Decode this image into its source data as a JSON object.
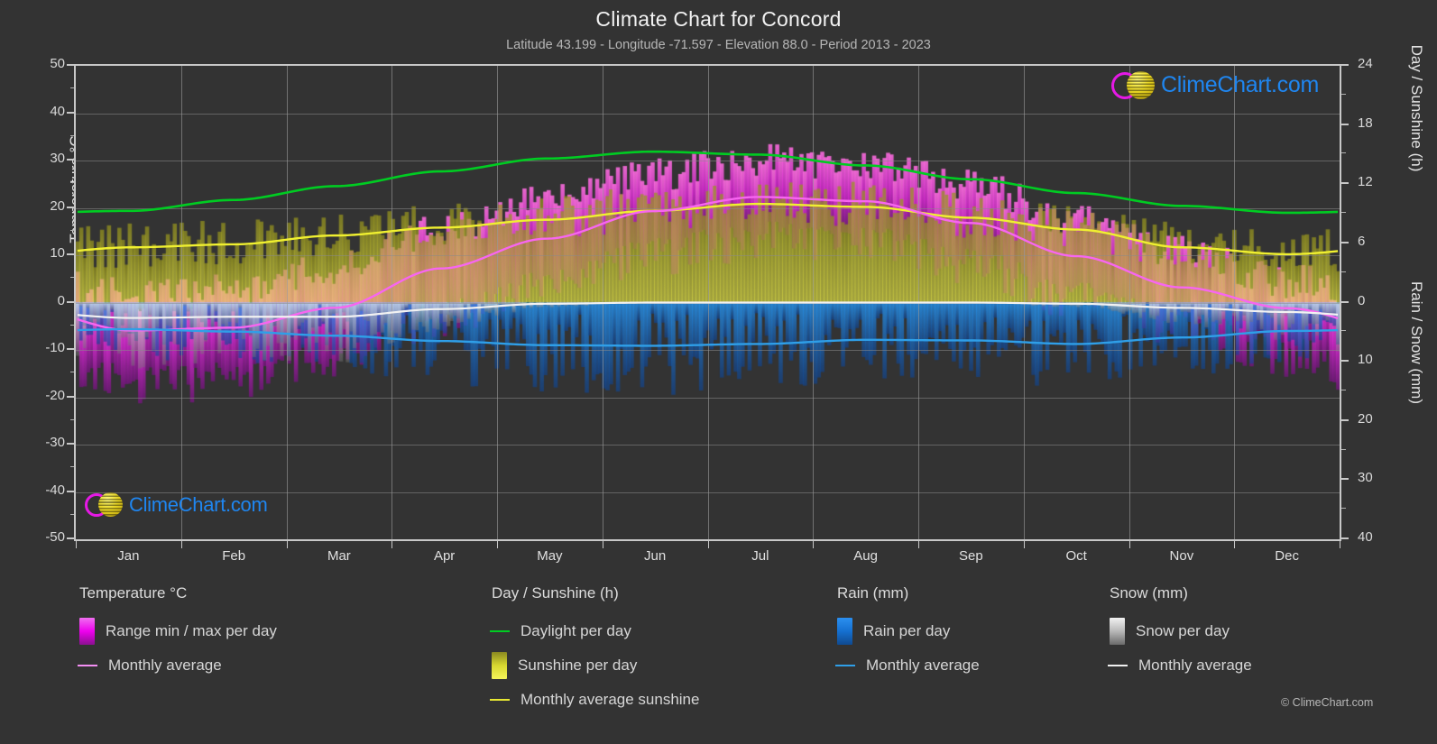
{
  "header": {
    "title": "Climate Chart for Concord",
    "subtitle": "Latitude 43.199 - Longitude -71.597 - Elevation 88.0 - Period 2013 - 2023"
  },
  "watermark": {
    "text": "ClimeChart.com"
  },
  "copyright": "© ClimeChart.com",
  "legend": {
    "columns": [
      {
        "title": "Temperature °C",
        "items": [
          {
            "label": "Range min / max per day",
            "marker": "gradient-swatch",
            "color": "#ee00ee"
          },
          {
            "label": "Monthly average",
            "marker": "line",
            "color": "#f48ff4"
          }
        ]
      },
      {
        "title": "Day / Sunshine (h)",
        "items": [
          {
            "label": "Daylight per day",
            "marker": "line",
            "color": "#00cc22"
          },
          {
            "label": "Sunshine per day",
            "marker": "gradient-swatch",
            "color": "#e8e833"
          },
          {
            "label": "Monthly average sunshine",
            "marker": "line",
            "color": "#e8e833"
          }
        ]
      },
      {
        "title": "Rain (mm)",
        "items": [
          {
            "label": "Rain per day",
            "marker": "gradient-swatch",
            "color": "#1a7fe0"
          },
          {
            "label": "Monthly average",
            "marker": "line",
            "color": "#2f9fe8"
          }
        ]
      },
      {
        "title": "Snow (mm)",
        "items": [
          {
            "label": "Snow per day",
            "marker": "gradient-swatch",
            "color": "#d8d8d8"
          },
          {
            "label": "Monthly average",
            "marker": "line",
            "color": "#f0f0f0"
          }
        ]
      }
    ]
  },
  "chart_data": {
    "type": "line",
    "title": "Climate Chart for Concord",
    "subtitle": "Latitude 43.199 - Longitude -71.597 - Elevation 88.0 - Period 2013 - 2023",
    "categories": [
      "Jan",
      "Feb",
      "Mar",
      "Apr",
      "May",
      "Jun",
      "Jul",
      "Aug",
      "Sep",
      "Oct",
      "Nov",
      "Dec"
    ],
    "xlabel": "",
    "grid": true,
    "legend_position": "below",
    "axes": {
      "left": {
        "label": "Temperature °C",
        "ylim": [
          -50,
          50
        ],
        "ticks": [
          50,
          40,
          30,
          20,
          10,
          0,
          -10,
          -20,
          -30,
          -40,
          -50
        ]
      },
      "right_upper": {
        "label": "Day / Sunshine (h)",
        "ylim": [
          0,
          24
        ],
        "ticks": [
          24,
          18,
          12,
          6,
          0
        ],
        "note": "0 h aligns with 0 °C; 24 h aligns with 50 °C"
      },
      "right_lower": {
        "label": "Rain / Snow (mm)",
        "ylim": [
          0,
          40
        ],
        "ticks": [
          0,
          10,
          20,
          30,
          40
        ],
        "note": "0 mm aligns with 0 °C and increases downward to 40 mm at -50 °C"
      }
    },
    "series": [
      {
        "name": "Daylight per day",
        "unit": "h",
        "axis": "right_upper",
        "color": "#00cc22",
        "values": [
          9.3,
          10.4,
          11.8,
          13.3,
          14.6,
          15.3,
          15.0,
          13.9,
          12.5,
          11.1,
          9.8,
          9.1
        ]
      },
      {
        "name": "Monthly average sunshine",
        "unit": "h",
        "axis": "right_upper",
        "color": "#e8e833",
        "values": [
          5.6,
          5.9,
          6.8,
          7.6,
          8.4,
          9.3,
          10.0,
          9.7,
          8.6,
          7.4,
          5.6,
          4.9
        ]
      },
      {
        "name": "Monthly average temperature",
        "unit": "°C",
        "axis": "left",
        "color": "#f48ff4",
        "values": [
          -5.9,
          -5.3,
          -1.1,
          7.2,
          13.5,
          19.3,
          22.3,
          21.4,
          16.8,
          9.8,
          3.2,
          -1.2
        ]
      },
      {
        "name": "Monthly average rain",
        "unit": "mm",
        "axis": "right_lower",
        "color": "#2f9fe8",
        "values": [
          4.5,
          4.9,
          5.6,
          6.5,
          7.2,
          7.3,
          7.0,
          6.3,
          6.4,
          7.0,
          5.9,
          4.8
        ]
      },
      {
        "name": "Monthly average snow",
        "unit": "mm",
        "axis": "right_lower",
        "color": "#f0f0f0",
        "values": [
          2.6,
          2.4,
          2.4,
          1.1,
          0.2,
          0.0,
          0.0,
          0.0,
          0.0,
          0.2,
          0.9,
          1.6
        ]
      },
      {
        "name": "Temperature range min per day",
        "unit": "°C",
        "axis": "left",
        "color": "#ee00ee",
        "values": [
          -16.0,
          -15.2,
          -10.0,
          -2.0,
          4.5,
          11.0,
          14.5,
          13.8,
          9.0,
          2.0,
          -4.0,
          -10.0
        ]
      },
      {
        "name": "Temperature range max per day",
        "unit": "°C",
        "axis": "left",
        "color": "#ee00ee",
        "values": [
          1.5,
          2.6,
          7.5,
          15.5,
          22.0,
          27.0,
          30.0,
          29.0,
          25.0,
          17.5,
          10.5,
          4.5
        ]
      }
    ]
  }
}
